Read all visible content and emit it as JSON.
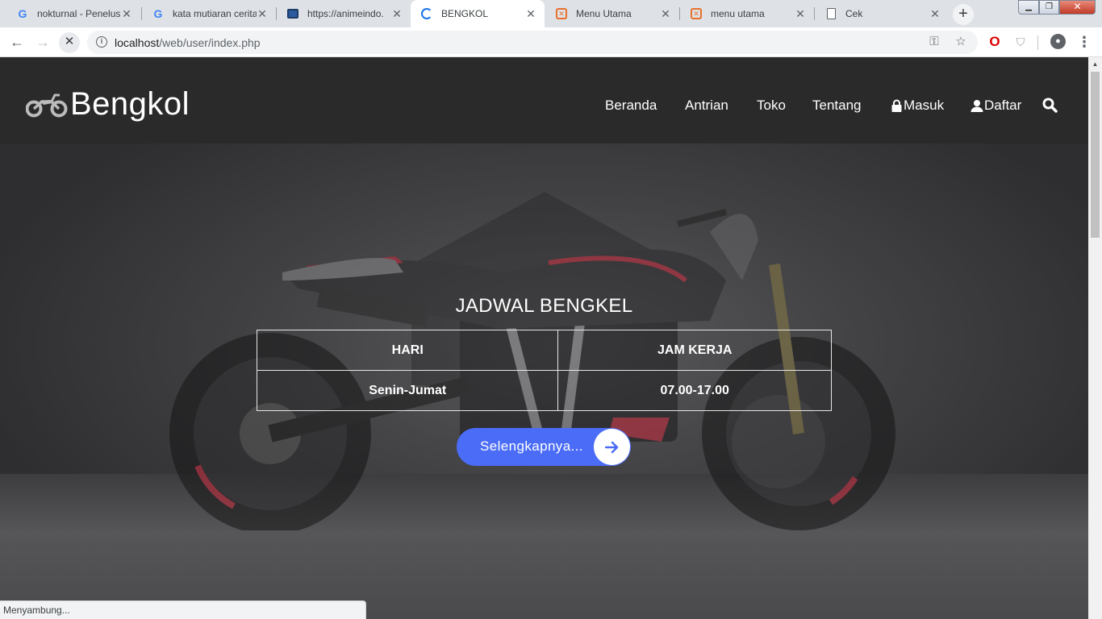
{
  "browser": {
    "tabs": [
      {
        "title": "nokturnal - Penelus",
        "favicon": "google-icon"
      },
      {
        "title": "kata mutiaran cerita",
        "favicon": "google-icon"
      },
      {
        "title": "https://animeindo.",
        "favicon": "tv-icon"
      },
      {
        "title": "BENGKOL",
        "favicon": "loading-spinner-icon",
        "active": true
      },
      {
        "title": "Menu Utama",
        "favicon": "xampp-icon"
      },
      {
        "title": "menu utama",
        "favicon": "xampp-icon"
      },
      {
        "title": "Cek",
        "favicon": "document-icon"
      }
    ],
    "url_host": "localhost",
    "url_path": "/web/user/index.php",
    "status_text": "Menyambung..."
  },
  "site": {
    "brand": "Bengkol",
    "brand_icon": "motorcycle-icon",
    "nav": [
      {
        "label": "Beranda"
      },
      {
        "label": "Antrian"
      },
      {
        "label": "Toko"
      },
      {
        "label": "Tentang"
      },
      {
        "label": "Masuk",
        "icon": "lock-icon"
      },
      {
        "label": "Daftar",
        "icon": "user-icon"
      }
    ],
    "search_icon": "search-icon"
  },
  "hero": {
    "title": "JADWAL BENGKEL",
    "table": {
      "headers": [
        "HARI",
        "JAM KERJA"
      ],
      "rows": [
        [
          "Senin-Jumat",
          "07.00-17.00"
        ]
      ]
    },
    "button_label": "Selengkapnya...",
    "button_icon": "arrow-right-icon"
  },
  "colors": {
    "header_bg": "#2a2a2b",
    "button_bg": "#4a6cf7",
    "accent_red": "#c8283a"
  }
}
